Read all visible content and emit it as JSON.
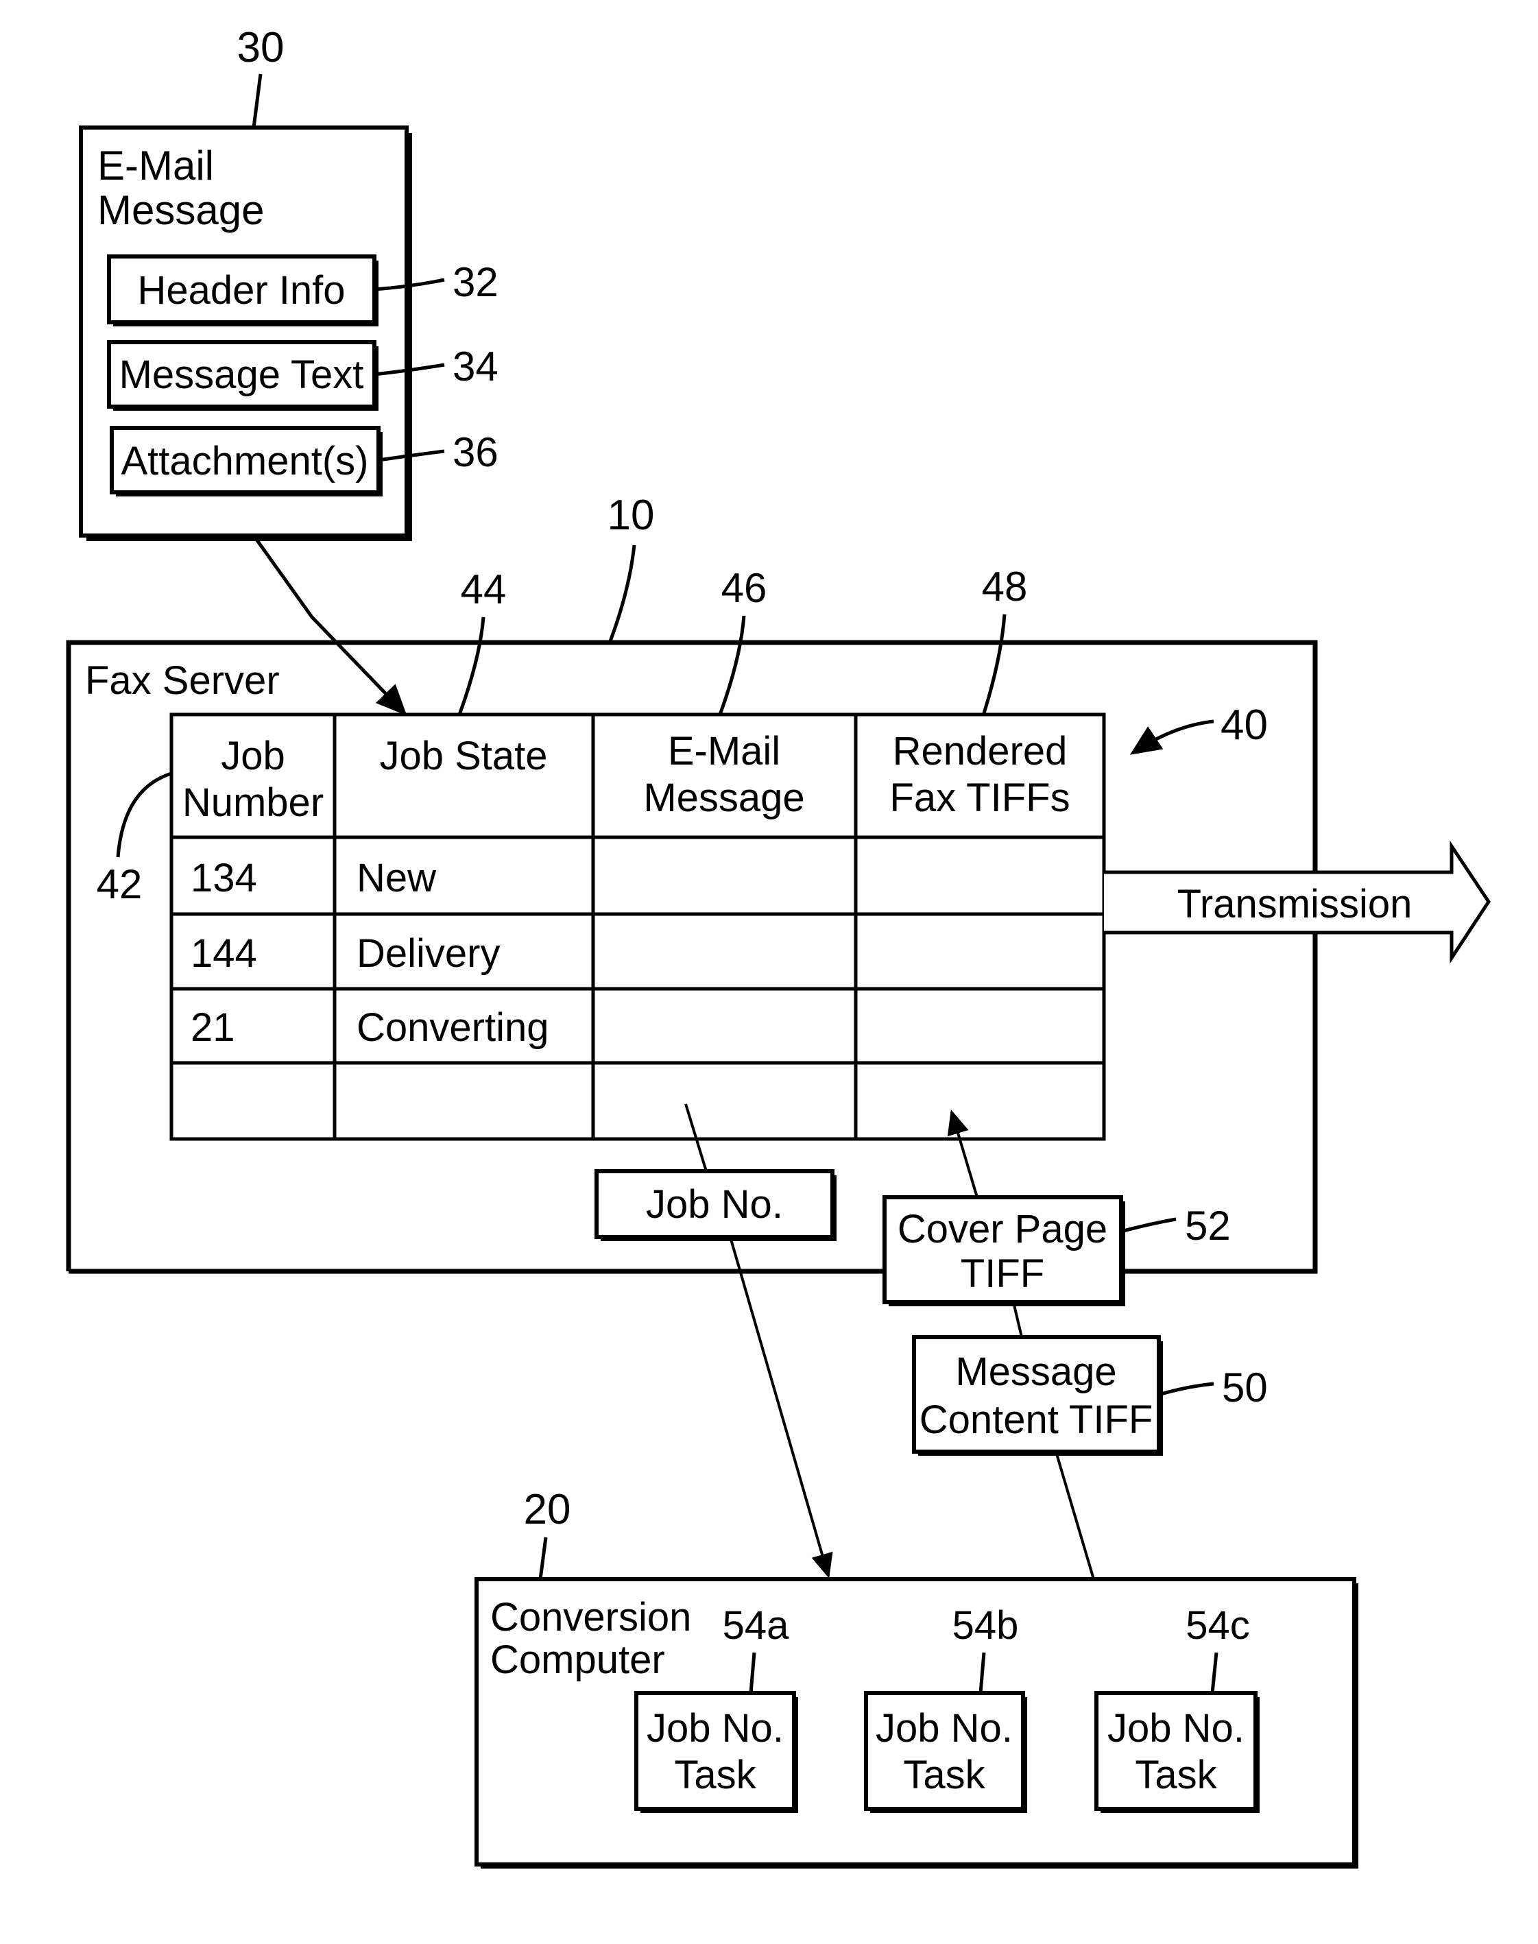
{
  "email_message": {
    "ref": "30",
    "title_line1": "E-Mail",
    "title_line2": "Message",
    "parts": [
      {
        "label": "Header Info",
        "ref": "32"
      },
      {
        "label": "Message Text",
        "ref": "34"
      },
      {
        "label": "Attachment(s)",
        "ref": "36"
      }
    ]
  },
  "fax_server": {
    "ref": "10",
    "title": "Fax Server",
    "table": {
      "ref": "40",
      "row_ref": "42",
      "columns": [
        {
          "line1": "Job",
          "line2": "Number",
          "ref": ""
        },
        {
          "line1": "Job State",
          "line2": "",
          "ref": "44"
        },
        {
          "line1": "E-Mail",
          "line2": "Message",
          "ref": "46"
        },
        {
          "line1": "Rendered",
          "line2": "Fax TIFFs",
          "ref": "48"
        }
      ],
      "rows": [
        {
          "job_number": "134",
          "job_state": "New"
        },
        {
          "job_number": "144",
          "job_state": "Delivery"
        },
        {
          "job_number": "21",
          "job_state": "Converting"
        },
        {
          "job_number": "",
          "job_state": ""
        }
      ]
    },
    "transmission_label": "Transmission",
    "job_no_label": "Job No."
  },
  "cover_page_tiff": {
    "line1": "Cover Page",
    "line2": "TIFF",
    "ref": "52"
  },
  "message_content_tiff": {
    "line1": "Message",
    "line2": "Content TIFF",
    "ref": "50"
  },
  "conversion_computer": {
    "ref": "20",
    "title_line1": "Conversion",
    "title_line2": "Computer",
    "tasks": [
      {
        "line1": "Job No.",
        "line2": "Task",
        "ref": "54a"
      },
      {
        "line1": "Job No.",
        "line2": "Task",
        "ref": "54b"
      },
      {
        "line1": "Job No.",
        "line2": "Task",
        "ref": "54c"
      }
    ]
  }
}
